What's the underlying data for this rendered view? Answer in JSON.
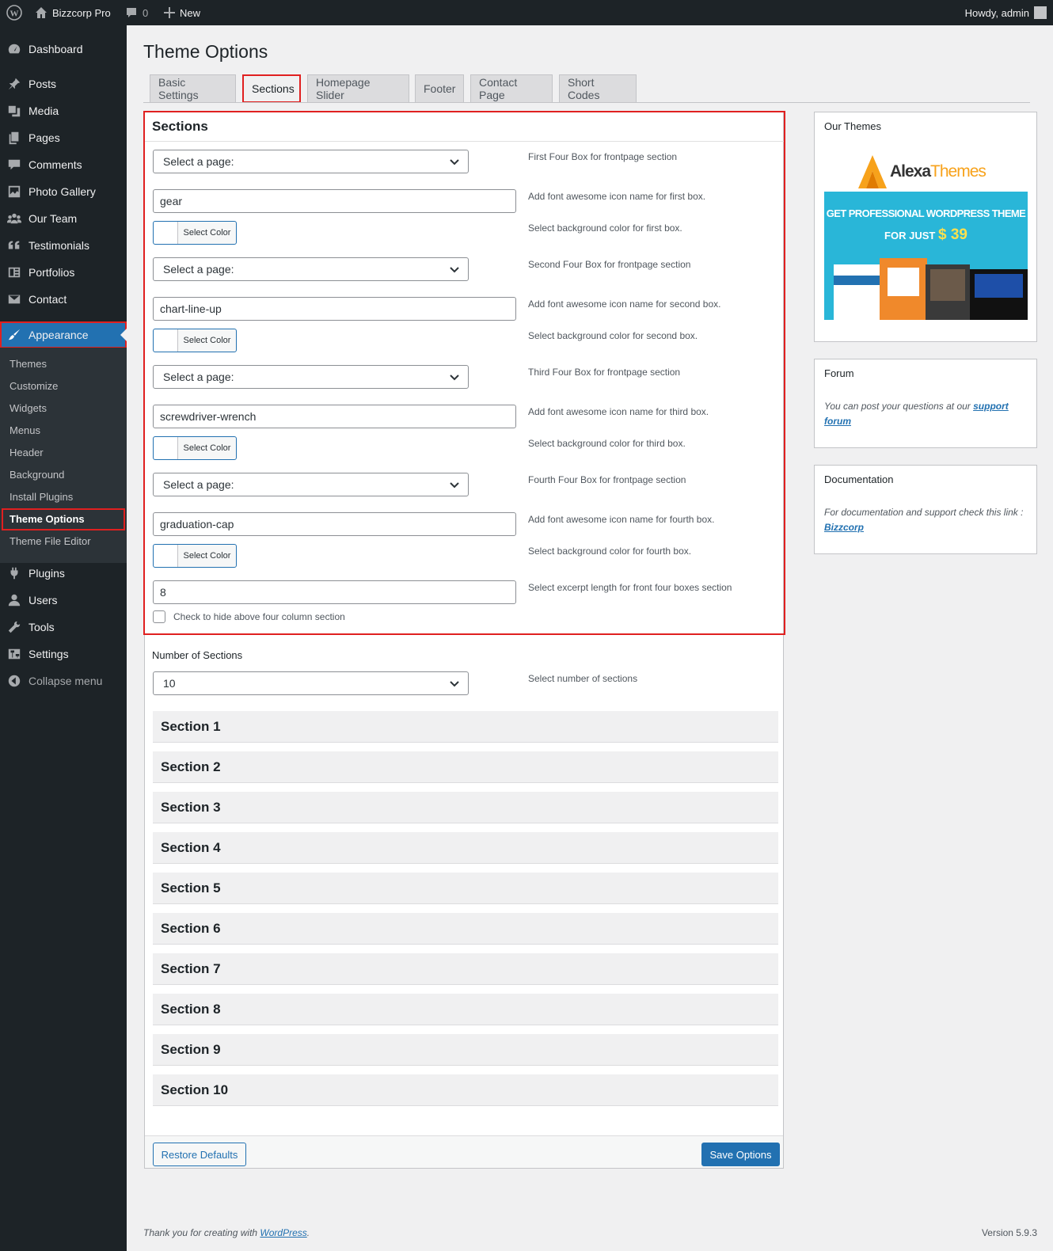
{
  "admin_bar": {
    "site_name": "Bizzcorp Pro",
    "comments_count": "0",
    "new_label": "New",
    "greeting": "Howdy, admin"
  },
  "sidebar": {
    "items": [
      {
        "label": "Dashboard",
        "icon": "dashboard-icon"
      },
      {
        "label": "Posts",
        "icon": "pin-icon"
      },
      {
        "label": "Media",
        "icon": "media-icon"
      },
      {
        "label": "Pages",
        "icon": "pages-icon"
      },
      {
        "label": "Comments",
        "icon": "comment-icon"
      },
      {
        "label": "Photo Gallery",
        "icon": "gallery-icon"
      },
      {
        "label": "Our Team",
        "icon": "team-icon"
      },
      {
        "label": "Testimonials",
        "icon": "quote-icon"
      },
      {
        "label": "Portfolios",
        "icon": "portfolio-icon"
      },
      {
        "label": "Contact",
        "icon": "envelope-icon"
      },
      {
        "label": "Appearance",
        "icon": "brush-icon"
      }
    ],
    "submenu": [
      "Themes",
      "Customize",
      "Widgets",
      "Menus",
      "Header",
      "Background",
      "Install Plugins",
      "Theme Options",
      "Theme File Editor"
    ],
    "items_after": [
      {
        "label": "Plugins",
        "icon": "plugin-icon"
      },
      {
        "label": "Users",
        "icon": "user-icon"
      },
      {
        "label": "Tools",
        "icon": "wrench-icon"
      },
      {
        "label": "Settings",
        "icon": "settings-icon"
      },
      {
        "label": "Collapse menu",
        "icon": "collapse-icon"
      }
    ]
  },
  "page_title": "Theme Options",
  "tabs": [
    "Basic Settings",
    "Sections",
    "Homepage Slider",
    "Footer",
    "Contact Page",
    "Short Codes"
  ],
  "active_tab": "Sections",
  "panel": {
    "title": "Sections",
    "boxes": [
      {
        "page_select": "Select a page:",
        "page_desc": "First Four Box for frontpage section",
        "icon_value": "gear",
        "icon_desc": "Add font awesome icon name for first box.",
        "color_label": "Select Color",
        "color_desc": "Select background color for first box."
      },
      {
        "page_select": "Select a page:",
        "page_desc": "Second Four Box for frontpage section",
        "icon_value": "chart-line-up",
        "icon_desc": "Add font awesome icon name for second box.",
        "color_label": "Select Color",
        "color_desc": "Select background color for second box."
      },
      {
        "page_select": "Select a page:",
        "page_desc": "Third Four Box for frontpage section",
        "icon_value": "screwdriver-wrench",
        "icon_desc": "Add font awesome icon name for third box.",
        "color_label": "Select Color",
        "color_desc": "Select background color for third box."
      },
      {
        "page_select": "Select a page:",
        "page_desc": "Fourth Four Box for frontpage section",
        "icon_value": "graduation-cap",
        "icon_desc": "Add font awesome icon name for fourth box.",
        "color_label": "Select Color",
        "color_desc": "Select background color for fourth box."
      }
    ],
    "excerpt_value": "8",
    "excerpt_desc": "Select excerpt length for front four boxes section",
    "hide_label": "Check to hide above four column section",
    "num_sections_label": "Number of Sections",
    "num_sections_value": "10",
    "num_sections_desc": "Select number of sections",
    "sections": [
      "Section 1",
      "Section 2",
      "Section 3",
      "Section 4",
      "Section 5",
      "Section 6",
      "Section 7",
      "Section 8",
      "Section 9",
      "Section 10"
    ],
    "restore_label": "Restore Defaults",
    "save_label": "Save Options"
  },
  "widgets": {
    "themes": {
      "title": "Our Themes",
      "logo_a": "Alexa",
      "logo_b": "Themes",
      "banner_line1": "GET PROFESSIONAL WORDPRESS THEME",
      "banner_line2": "FOR JUST",
      "price": "$ 39"
    },
    "forum": {
      "title": "Forum",
      "text": "You can post your questions at our ",
      "link": "support forum"
    },
    "docs": {
      "title": "Documentation",
      "text": "For documentation and support check this link : ",
      "link": "Bizzcorp"
    }
  },
  "footer": {
    "text": "Thank you for creating with ",
    "link": "WordPress",
    "suffix": ".",
    "version": "Version 5.9.3"
  },
  "colors": {
    "accent": "#2271b1",
    "highlight": "#e02020",
    "sidebar": "#1d2327"
  }
}
